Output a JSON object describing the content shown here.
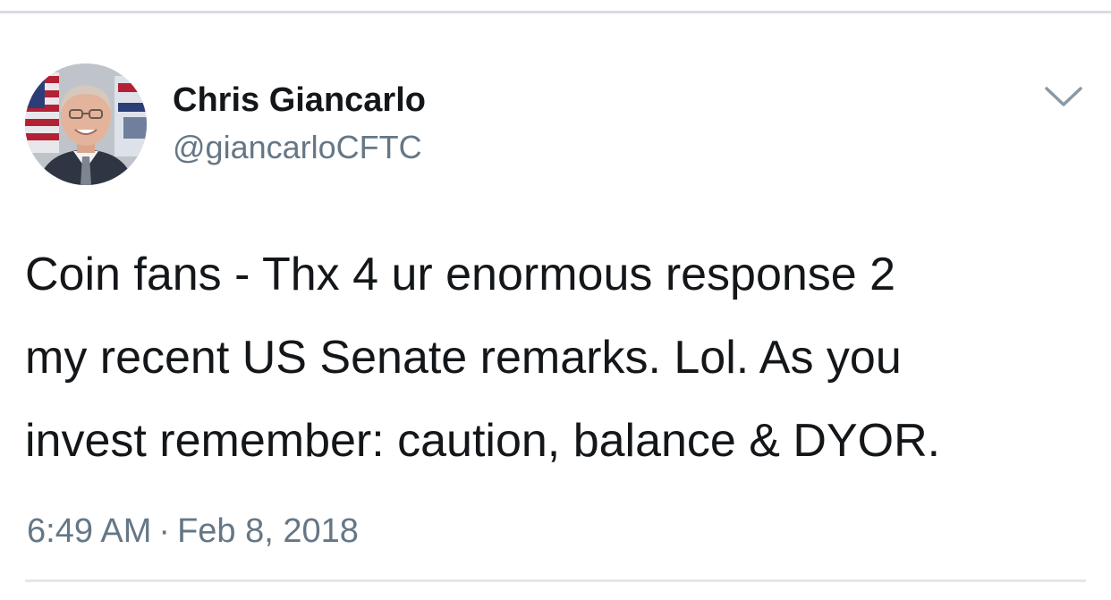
{
  "tweet": {
    "author": {
      "display_name": "Chris Giancarlo",
      "handle": "@giancarloCFTC",
      "avatar_icon": "profile-photo-avatar"
    },
    "menu_icon": "chevron-down-icon",
    "text_lines": [
      "Coin fans - Thx 4 ur enormous response 2",
      "my recent US Senate remarks.  Lol. As you",
      "invest remember: caution, balance & DYOR."
    ],
    "time": "6:49 AM",
    "separator": "·",
    "date": "Feb 8, 2018"
  },
  "colors": {
    "text_primary": "#14171a",
    "text_secondary": "#657786",
    "divider": "#e1e8ed"
  }
}
